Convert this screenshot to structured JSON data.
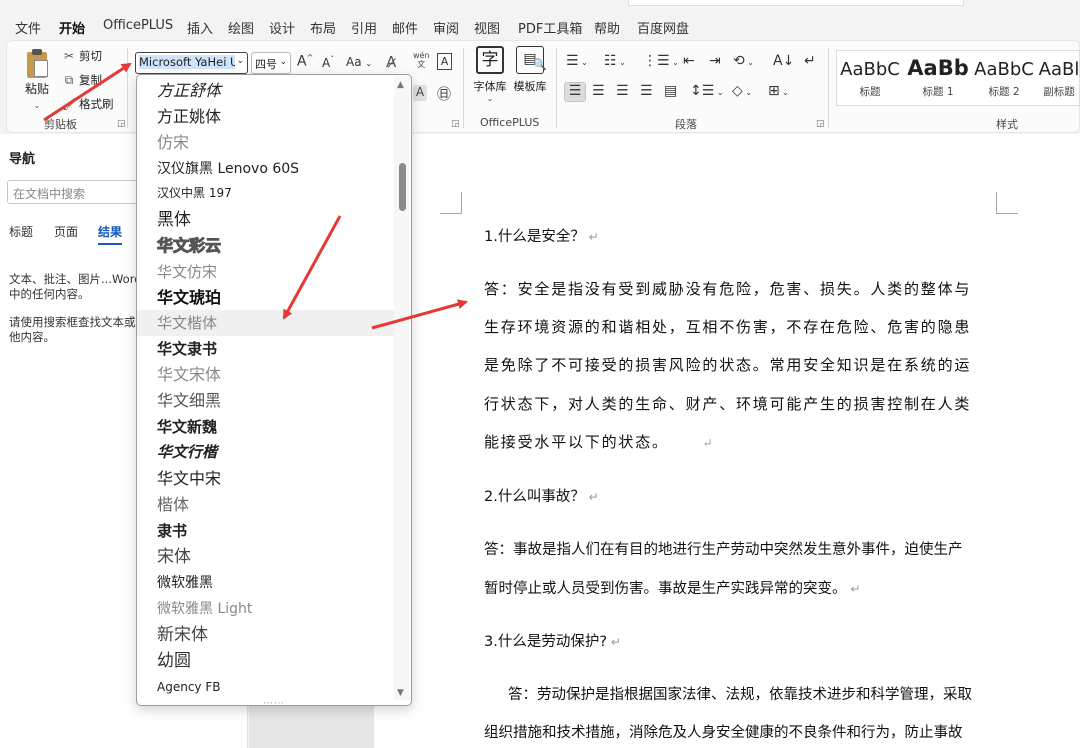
{
  "menu": {
    "tabs": [
      "文件",
      "开始",
      "OfficePLUS",
      "插入",
      "绘图",
      "设计",
      "布局",
      "引用",
      "邮件",
      "审阅",
      "视图",
      "PDF工具箱",
      "帮助",
      "百度网盘"
    ],
    "active_index": 1
  },
  "ribbon": {
    "clipboard": {
      "paste": "粘贴",
      "cut": "剪切",
      "copy": "复制",
      "format_painter": "格式刷",
      "group": "剪贴板"
    },
    "font": {
      "current_font": "Microsoft YaHei UI",
      "current_size": "四号",
      "grow": "A",
      "shrink": "A",
      "change_case": "Aa"
    },
    "officeplus": {
      "font_lib": "字体库",
      "template_lib": "模板库",
      "font_lib_glyph": "字",
      "group": "OfficePLUS"
    },
    "paragraph": {
      "group": "段落"
    },
    "styles": {
      "group": "样式",
      "items": [
        {
          "sample": "AaBbC",
          "name": "标题"
        },
        {
          "sample": "AaBb",
          "name": "标题 1"
        },
        {
          "sample": "AaBbC",
          "name": "标题 2"
        },
        {
          "sample": "AaBl",
          "name": "副标题"
        }
      ]
    }
  },
  "nav": {
    "title": "导航",
    "search_placeholder": "在文档中搜索",
    "tabs": [
      "标题",
      "页面",
      "结果"
    ],
    "active_tab": "结果",
    "msg1_line1": "文本、批注、图片...Word",
    "msg1_line2": "中的任何内容。",
    "msg2_line1": "请使用搜索框查找文本或者",
    "msg2_line2": "他内容。"
  },
  "font_list": [
    {
      "name": "方正舒体",
      "size": 16,
      "weight": "normal",
      "color": "#222",
      "italic": true
    },
    {
      "name": "方正姚体",
      "size": 16,
      "weight": "normal",
      "color": "#222",
      "italic": false
    },
    {
      "name": "仿宋",
      "size": 16,
      "weight": "normal",
      "color": "#888",
      "italic": false
    },
    {
      "name": "汉仪旗黑 Lenovo 60S",
      "size": 14,
      "weight": "normal",
      "color": "#222",
      "italic": false
    },
    {
      "name": "汉仪中黑 197",
      "size": 12,
      "weight": "normal",
      "color": "#222",
      "italic": false
    },
    {
      "name": "黑体",
      "size": 17,
      "weight": "normal",
      "color": "#222",
      "italic": false
    },
    {
      "name": "华文彩云",
      "size": 16,
      "weight": "bold",
      "color": "#bbb",
      "italic": false
    },
    {
      "name": "华文仿宋",
      "size": 15,
      "weight": "normal",
      "color": "#888",
      "italic": false
    },
    {
      "name": "华文琥珀",
      "size": 16,
      "weight": "bold",
      "color": "#111",
      "italic": false
    },
    {
      "name": "华文楷体",
      "size": 15,
      "weight": "normal",
      "color": "#888",
      "italic": false
    },
    {
      "name": "华文隶书",
      "size": 15,
      "weight": "bold",
      "color": "#222",
      "italic": false
    },
    {
      "name": "华文宋体",
      "size": 16,
      "weight": "normal",
      "color": "#888",
      "italic": false
    },
    {
      "name": "华文细黑",
      "size": 16,
      "weight": "normal",
      "color": "#555",
      "italic": false
    },
    {
      "name": "华文新魏",
      "size": 15,
      "weight": "bold",
      "color": "#222",
      "italic": false
    },
    {
      "name": "华文行楷",
      "size": 15,
      "weight": "bold",
      "color": "#222",
      "italic": true
    },
    {
      "name": "华文中宋",
      "size": 16,
      "weight": "normal",
      "color": "#222",
      "italic": false
    },
    {
      "name": "楷体",
      "size": 16,
      "weight": "normal",
      "color": "#666",
      "italic": false
    },
    {
      "name": "隶书",
      "size": 15,
      "weight": "bold",
      "color": "#222",
      "italic": false
    },
    {
      "name": "宋体",
      "size": 17,
      "weight": "normal",
      "color": "#444",
      "italic": false
    },
    {
      "name": "微软雅黑",
      "size": 14,
      "weight": "normal",
      "color": "#222",
      "italic": false
    },
    {
      "name": "微软雅黑 Light",
      "size": 14,
      "weight": "normal",
      "color": "#888",
      "italic": false
    },
    {
      "name": "新宋体",
      "size": 17,
      "weight": "normal",
      "color": "#444",
      "italic": false
    },
    {
      "name": "幼圆",
      "size": 17,
      "weight": "normal",
      "color": "#333",
      "italic": false
    },
    {
      "name": "Agency FB",
      "size": 12,
      "weight": "normal",
      "color": "#222",
      "italic": false
    }
  ],
  "hover_font_index": 9,
  "document": {
    "lines": [
      {
        "text": "1.什么是安全？",
        "mark": "↵",
        "kai": false
      },
      {
        "text": "答：安全是指没有受到威胁没有危险，危害、损失。人类的整体与",
        "mark": "",
        "kai": true
      },
      {
        "text": "生存环境资源的和谐相处，互相不伤害，不存在危险、危害的隐患",
        "mark": "",
        "kai": true
      },
      {
        "text": "是免除了不可接受的损害风险的状态。常用安全知识是在系统的运",
        "mark": "",
        "kai": true
      },
      {
        "text": "行状态下，对人类的生命、财产、环境可能产生的损害控制在人类",
        "mark": "",
        "kai": true
      },
      {
        "text": "能接受水平以下的状态。",
        "mark": "↵",
        "kai": true
      },
      {
        "text": "2.什么叫事故？",
        "mark": "↵",
        "kai": false
      },
      {
        "text": "答：事故是指人们在有目的地进行生产劳动中突然发生意外事件，迫使生产",
        "mark": "",
        "kai": false
      },
      {
        "text": "暂时停止或人员受到伤害。事故是生产实践异常的突变。",
        "mark": "↵",
        "kai": false
      },
      {
        "text": "3.什么是劳动保护?",
        "mark": "↵",
        "kai": false
      },
      {
        "text": "答：劳动保护是指根据国家法律、法规，依靠技术进步和科学管理，采取",
        "mark": "",
        "kai": false
      },
      {
        "text": "组织措施和技术措施，消除危及人身安全健康的不良条件和行为，防止事故",
        "mark": "",
        "kai": false
      }
    ]
  },
  "colors": {
    "accent": "#185abd",
    "arrow": "#e53935",
    "font_highlight": "#cfe3fa"
  }
}
